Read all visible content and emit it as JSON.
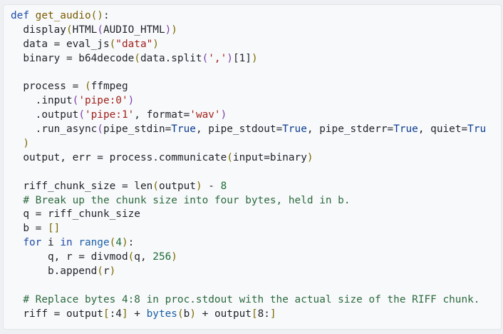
{
  "code_lines": [
    [
      [
        "kw",
        "def "
      ],
      [
        "fn",
        "get_audio"
      ],
      [
        "br1",
        "()"
      ],
      [
        "tx",
        ":"
      ]
    ],
    [
      [
        "tx",
        "  display"
      ],
      [
        "br1",
        "("
      ],
      [
        "tx",
        "HTML"
      ],
      [
        "br2",
        "("
      ],
      [
        "tx",
        "AUDIO_HTML"
      ],
      [
        "br2",
        ")"
      ],
      [
        "br1",
        ")"
      ]
    ],
    [
      [
        "tx",
        "  data = eval_js"
      ],
      [
        "br1",
        "("
      ],
      [
        "str",
        "\"data\""
      ],
      [
        "br1",
        ")"
      ]
    ],
    [
      [
        "tx",
        "  binary = b64decode"
      ],
      [
        "br1",
        "("
      ],
      [
        "tx",
        "data.split"
      ],
      [
        "br2",
        "("
      ],
      [
        "str",
        "','"
      ],
      [
        "br2",
        ")"
      ],
      [
        "tx",
        "[1]"
      ],
      [
        "br1",
        ")"
      ]
    ],
    [],
    [
      [
        "tx",
        "  process = "
      ],
      [
        "br1",
        "("
      ],
      [
        "tx",
        "ffmpeg"
      ]
    ],
    [
      [
        "tx",
        "    .input"
      ],
      [
        "br2",
        "("
      ],
      [
        "str",
        "'pipe:0'"
      ],
      [
        "br2",
        ")"
      ]
    ],
    [
      [
        "tx",
        "    .output"
      ],
      [
        "br2",
        "("
      ],
      [
        "str",
        "'pipe:1'"
      ],
      [
        "tx",
        ", format="
      ],
      [
        "str",
        "'wav'"
      ],
      [
        "br2",
        ")"
      ]
    ],
    [
      [
        "tx",
        "    .run_async"
      ],
      [
        "br2",
        "("
      ],
      [
        "tx",
        "pipe_stdin="
      ],
      [
        "kwc",
        "True"
      ],
      [
        "tx",
        ", pipe_stdout="
      ],
      [
        "kwc",
        "True"
      ],
      [
        "tx",
        ", pipe_stderr="
      ],
      [
        "kwc",
        "True"
      ],
      [
        "tx",
        ", quiet="
      ],
      [
        "kwc",
        "Tru"
      ]
    ],
    [
      [
        "br1",
        "  )"
      ]
    ],
    [
      [
        "tx",
        "  output, err = process.communicate"
      ],
      [
        "br1",
        "("
      ],
      [
        "tx",
        "input=binary"
      ],
      [
        "br1",
        ")"
      ]
    ],
    [],
    [
      [
        "tx",
        "  riff_chunk_size = len"
      ],
      [
        "br1",
        "("
      ],
      [
        "tx",
        "output"
      ],
      [
        "br1",
        ")"
      ],
      [
        "tx",
        " - "
      ],
      [
        "num",
        "8"
      ]
    ],
    [
      [
        "com",
        "  # Break up the chunk size into four bytes, held in b."
      ]
    ],
    [
      [
        "tx",
        "  q = riff_chunk_size"
      ]
    ],
    [
      [
        "tx",
        "  b = "
      ],
      [
        "br1",
        "[]"
      ]
    ],
    [
      [
        "kw",
        "  for "
      ],
      [
        "tx",
        "i "
      ],
      [
        "kw",
        "in "
      ],
      [
        "bi",
        "range"
      ],
      [
        "br1",
        "("
      ],
      [
        "num",
        "4"
      ],
      [
        "br1",
        ")"
      ],
      [
        "tx",
        ":"
      ]
    ],
    [
      [
        "tx",
        "      q, r = divmod"
      ],
      [
        "br1",
        "("
      ],
      [
        "tx",
        "q, "
      ],
      [
        "num",
        "256"
      ],
      [
        "br1",
        ")"
      ]
    ],
    [
      [
        "tx",
        "      b.append"
      ],
      [
        "br1",
        "("
      ],
      [
        "tx",
        "r"
      ],
      [
        "br1",
        ")"
      ]
    ],
    [],
    [
      [
        "com",
        "  # Replace bytes 4:8 in proc.stdout with the actual size of the RIFF chunk."
      ]
    ],
    [
      [
        "tx",
        "  riff = output"
      ],
      [
        "br1",
        "["
      ],
      [
        "tx",
        ":4"
      ],
      [
        "br1",
        "]"
      ],
      [
        "tx",
        " + "
      ],
      [
        "bi",
        "bytes"
      ],
      [
        "br1",
        "("
      ],
      [
        "tx",
        "b"
      ],
      [
        "br1",
        ")"
      ],
      [
        "tx",
        " + output"
      ],
      [
        "br1",
        "["
      ],
      [
        "tx",
        "8:"
      ],
      [
        "br1",
        "]"
      ]
    ]
  ]
}
